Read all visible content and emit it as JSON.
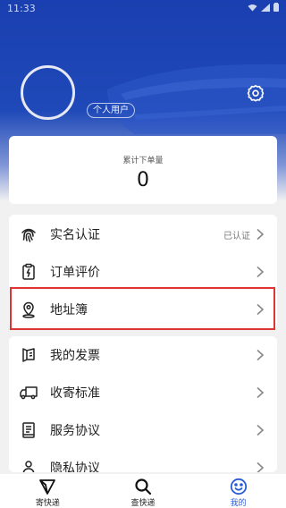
{
  "status_bar": {
    "time": "11:33"
  },
  "profile": {
    "user_type_label": "个人用户"
  },
  "stats": {
    "label": "累计下单量",
    "value": "0"
  },
  "menu_group_1": [
    {
      "label": "实名认证",
      "status": "已认证",
      "icon": "fingerprint-icon"
    },
    {
      "label": "订单评价",
      "status": "",
      "icon": "clipboard-icon"
    },
    {
      "label": "地址簿",
      "status": "",
      "icon": "location-pin-icon"
    }
  ],
  "menu_group_2": [
    {
      "label": "我的发票",
      "icon": "invoice-icon"
    },
    {
      "label": "收寄标准",
      "icon": "truck-icon"
    },
    {
      "label": "服务协议",
      "icon": "document-icon"
    },
    {
      "label": "隐私协议",
      "icon": "person-icon"
    }
  ],
  "tabs": [
    {
      "label": "寄快递",
      "icon": "send-icon",
      "active": false
    },
    {
      "label": "查快递",
      "icon": "search-icon",
      "active": false
    },
    {
      "label": "我的",
      "icon": "smiley-icon",
      "active": true
    }
  ],
  "colors": {
    "header_blue": "#1f49b8",
    "accent": "#2a5bd7",
    "highlight_red": "#e03434"
  }
}
